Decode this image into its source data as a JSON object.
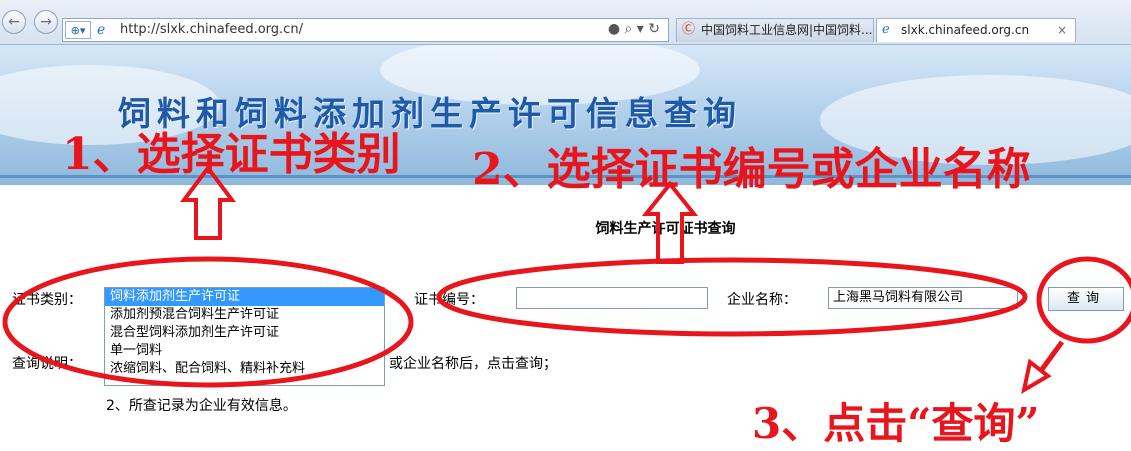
{
  "browser": {
    "back_label": "←",
    "forward_label": "→",
    "url": "http://slxk.chinafeed.org.cn/",
    "tools": "● ⌕ ▾ ↻",
    "tabs": [
      {
        "label": "中国饲料工业信息网|中国饲料..."
      },
      {
        "label": "slxk.chinafeed.org.cn"
      }
    ],
    "tab_close": "×"
  },
  "banner": {
    "title": "饲料和饲料添加剂生产许可信息查询"
  },
  "form": {
    "heading": "饲料生产许可证书查询",
    "cert_type_label": "证书类别：",
    "cert_type_options": [
      "饲料添加剂生产许可证",
      "添加剂预混合饲料生产许可证",
      "混合型饲料添加剂生产许可证",
      "单一饲料",
      "浓缩饲料、配合饲料、精料补充料"
    ],
    "cert_no_label": "证书编号：",
    "cert_no_value": "",
    "company_label": "企业名称：",
    "company_value": "上海黑马饲料有限公司",
    "query_button": "查询",
    "notes_label": "查询说明：",
    "note1_tail": "或企业名称后，点击查询；",
    "note2": "2、所查记录为企业有效信息。"
  },
  "annotations": {
    "step1": "1、选择证书类别",
    "step2": "2、选择证书编号或企业名称",
    "step3": "3、点击“查询”",
    "color": "#e8161c"
  }
}
